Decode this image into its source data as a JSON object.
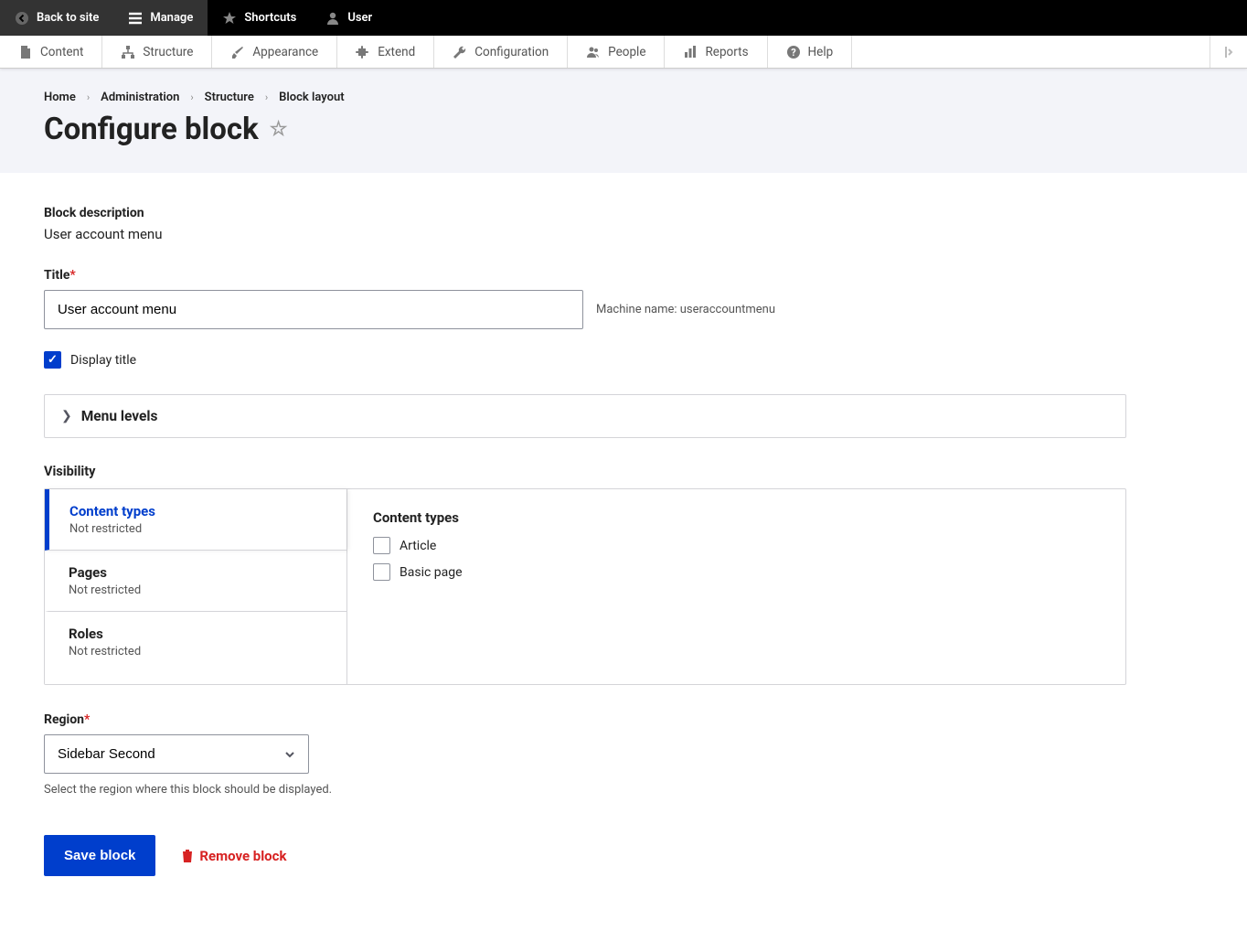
{
  "toolbar_top": {
    "back": "Back to site",
    "manage": "Manage",
    "shortcuts": "Shortcuts",
    "user": "User"
  },
  "toolbar_admin": {
    "items": [
      {
        "label": "Content"
      },
      {
        "label": "Structure"
      },
      {
        "label": "Appearance"
      },
      {
        "label": "Extend"
      },
      {
        "label": "Configuration"
      },
      {
        "label": "People"
      },
      {
        "label": "Reports"
      },
      {
        "label": "Help"
      }
    ]
  },
  "breadcrumb": {
    "items": [
      "Home",
      "Administration",
      "Structure",
      "Block layout"
    ]
  },
  "page_title": "Configure block",
  "form": {
    "block_description_label": "Block description",
    "block_description_value": "User account menu",
    "title_label": "Title",
    "title_value": "User account menu",
    "machine_name_label": "Machine name: useraccountmenu",
    "display_title_label": "Display title",
    "menu_levels_label": "Menu levels",
    "visibility_label": "Visibility",
    "vtabs": [
      {
        "name": "Content types",
        "sub": "Not restricted"
      },
      {
        "name": "Pages",
        "sub": "Not restricted"
      },
      {
        "name": "Roles",
        "sub": "Not restricted"
      }
    ],
    "pane": {
      "title": "Content types",
      "options": [
        "Article",
        "Basic page"
      ]
    },
    "region_label": "Region",
    "region_value": "Sidebar Second",
    "region_help": "Select the region where this block should be displayed.",
    "save_label": "Save block",
    "remove_label": "Remove block"
  }
}
